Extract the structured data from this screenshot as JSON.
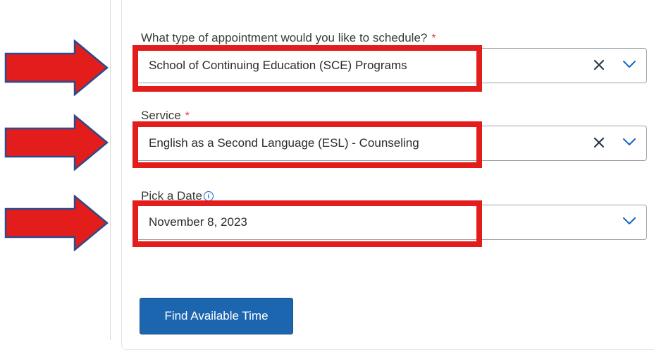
{
  "form": {
    "appointment": {
      "label": "What type of appointment would you like to schedule?",
      "required_mark": "*",
      "value": "School of Continuing Education (SCE) Programs"
    },
    "service": {
      "label": "Service",
      "required_mark": "*",
      "value": "English as a Second Language (ESL) - Counseling"
    },
    "date": {
      "label": "Pick a Date",
      "value": "November 8, 2023"
    },
    "submit_label": "Find Available Time"
  },
  "icons": {
    "info": "info-icon",
    "clear": "close-icon",
    "chevron": "chevron-down-icon",
    "annotation": "right-arrow-icon"
  },
  "colors": {
    "highlight": "#e31c1c",
    "arrow_fill": "#e31c1c",
    "arrow_outline": "#2a4b8d",
    "button": "#1c66b0",
    "accent": "#1565c0",
    "required": "#d64545"
  }
}
